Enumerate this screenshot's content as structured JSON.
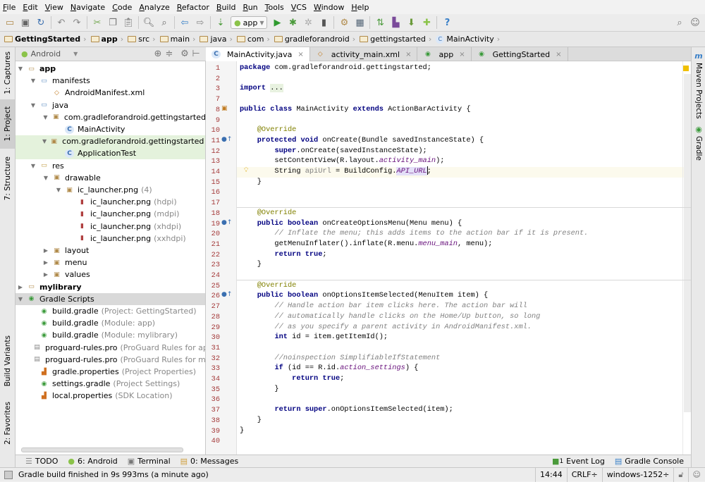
{
  "menu": [
    "File",
    "Edit",
    "View",
    "Navigate",
    "Code",
    "Analyze",
    "Refactor",
    "Build",
    "Run",
    "Tools",
    "VCS",
    "Window",
    "Help"
  ],
  "toolbar": {
    "run_config": "app"
  },
  "breadcrumb": [
    "GettingStarted",
    "app",
    "src",
    "main",
    "java",
    "com",
    "gradleforandroid",
    "gettingstarted",
    "MainActivity"
  ],
  "left_stripe": [
    "1: Captures",
    "1: Project",
    "7: Structure",
    "Build Variants",
    "2: Favorites"
  ],
  "right_stripe": [
    "Maven Projects",
    "Gradle"
  ],
  "project_panel": {
    "view": "Android"
  },
  "tree": [
    {
      "depth": 0,
      "tri": "open",
      "icon": "module",
      "label": "app",
      "bold": true
    },
    {
      "depth": 1,
      "tri": "open",
      "icon": "folder",
      "label": "manifests"
    },
    {
      "depth": 2,
      "icon": "xml",
      "label": "AndroidManifest.xml"
    },
    {
      "depth": 1,
      "tri": "open",
      "icon": "folder",
      "label": "java"
    },
    {
      "depth": 2,
      "tri": "open",
      "icon": "package",
      "label": "com.gradleforandroid.gettingstarted"
    },
    {
      "depth": 3,
      "icon": "class",
      "label": "MainActivity"
    },
    {
      "depth": 2,
      "tri": "open",
      "icon": "package",
      "label": "com.gradleforandroid.gettingstarted",
      "muted": "(androidTest)",
      "state": "sel"
    },
    {
      "depth": 3,
      "icon": "testclass",
      "label": "ApplicationTest",
      "state": "sel"
    },
    {
      "depth": 1,
      "tri": "open",
      "icon": "resfolder",
      "label": "res"
    },
    {
      "depth": 2,
      "tri": "open",
      "icon": "package",
      "label": "drawable"
    },
    {
      "depth": 3,
      "tri": "open",
      "icon": "package",
      "label": "ic_launcher.png",
      "muted": "(4)"
    },
    {
      "depth": 4,
      "icon": "image",
      "label": "ic_launcher.png",
      "muted": "(hdpi)"
    },
    {
      "depth": 4,
      "icon": "image",
      "label": "ic_launcher.png",
      "muted": "(mdpi)"
    },
    {
      "depth": 4,
      "icon": "image",
      "label": "ic_launcher.png",
      "muted": "(xhdpi)"
    },
    {
      "depth": 4,
      "icon": "image",
      "label": "ic_launcher.png",
      "muted": "(xxhdpi)"
    },
    {
      "depth": 2,
      "tri": "closed",
      "icon": "package",
      "label": "layout"
    },
    {
      "depth": 2,
      "tri": "closed",
      "icon": "package",
      "label": "menu"
    },
    {
      "depth": 2,
      "tri": "closed",
      "icon": "package",
      "label": "values"
    },
    {
      "depth": 0,
      "tri": "closed",
      "icon": "module",
      "label": "mylibrary",
      "bold": true
    },
    {
      "depth": 0,
      "tri": "open",
      "icon": "gradle",
      "label": "Gradle Scripts",
      "state": "hl"
    },
    {
      "depth": 1,
      "icon": "gradle",
      "label": "build.gradle",
      "muted": "(Project: GettingStarted)"
    },
    {
      "depth": 1,
      "icon": "gradle",
      "label": "build.gradle",
      "muted": "(Module: app)"
    },
    {
      "depth": 1,
      "icon": "gradle",
      "label": "build.gradle",
      "muted": "(Module: mylibrary)"
    },
    {
      "depth": 1,
      "icon": "text",
      "label": "proguard-rules.pro",
      "muted": "(ProGuard Rules for app)"
    },
    {
      "depth": 1,
      "icon": "text",
      "label": "proguard-rules.pro",
      "muted": "(ProGuard Rules for mylibrary)"
    },
    {
      "depth": 1,
      "icon": "props",
      "label": "gradle.properties",
      "muted": "(Project Properties)"
    },
    {
      "depth": 1,
      "icon": "gradle",
      "label": "settings.gradle",
      "muted": "(Project Settings)"
    },
    {
      "depth": 1,
      "icon": "props",
      "label": "local.properties",
      "muted": "(SDK Location)"
    }
  ],
  "editor_tabs": [
    {
      "label": "MainActivity.java",
      "icon": "class",
      "active": true
    },
    {
      "label": "activity_main.xml",
      "icon": "xml"
    },
    {
      "label": "app",
      "icon": "gradle"
    },
    {
      "label": "GettingStarted",
      "icon": "gradle"
    }
  ],
  "code": [
    {
      "n": "1",
      "s": [
        [
          "k",
          "package"
        ],
        [
          "p",
          " com.gradleforandroid.gettingstarted;"
        ]
      ]
    },
    {
      "n": "2",
      "s": []
    },
    {
      "n": "3",
      "s": [
        [
          "k",
          "import"
        ],
        [
          "p",
          " "
        ],
        [
          "fb",
          "..."
        ]
      ]
    },
    {
      "n": "7",
      "s": []
    },
    {
      "n": "8",
      "s": [
        [
          "k",
          "public class"
        ],
        [
          "p",
          " MainActivity "
        ],
        [
          "k",
          "extends"
        ],
        [
          "p",
          " ActionBarActivity {"
        ]
      ],
      "mark": "activity"
    },
    {
      "n": "9",
      "s": []
    },
    {
      "n": "10",
      "s": [
        [
          "p",
          "    "
        ],
        [
          "a",
          "@Override"
        ]
      ]
    },
    {
      "n": "11",
      "s": [
        [
          "p",
          "    "
        ],
        [
          "k",
          "protected void"
        ],
        [
          "p",
          " onCreate(Bundle savedInstanceState) {"
        ]
      ],
      "mark": "override"
    },
    {
      "n": "12",
      "s": [
        [
          "p",
          "        "
        ],
        [
          "k",
          "super"
        ],
        [
          "p",
          ".onCreate(savedInstanceState);"
        ]
      ]
    },
    {
      "n": "13",
      "s": [
        [
          "p",
          "        setContentView(R.layout."
        ],
        [
          "f",
          "activity_main"
        ],
        [
          "p",
          ");"
        ]
      ]
    },
    {
      "n": "14",
      "s": [
        [
          "p",
          "        String "
        ],
        [
          "g",
          "apiUrl"
        ],
        [
          "p",
          " = BuildConfig."
        ],
        [
          "fh",
          "API_URL"
        ],
        [
          "p",
          ";"
        ]
      ],
      "current": true,
      "mark": "bulb"
    },
    {
      "n": "15",
      "s": [
        [
          "p",
          "    }"
        ]
      ]
    },
    {
      "n": "16",
      "s": []
    },
    {
      "n": "17",
      "s": [],
      "sep": true
    },
    {
      "n": "18",
      "s": [
        [
          "p",
          "    "
        ],
        [
          "a",
          "@Override"
        ]
      ]
    },
    {
      "n": "19",
      "s": [
        [
          "p",
          "    "
        ],
        [
          "k",
          "public boolean"
        ],
        [
          "p",
          " onCreateOptionsMenu(Menu menu) {"
        ]
      ],
      "mark": "override"
    },
    {
      "n": "20",
      "s": [
        [
          "p",
          "        "
        ],
        [
          "c",
          "// Inflate the menu; this adds items to the action bar if it is present."
        ]
      ]
    },
    {
      "n": "21",
      "s": [
        [
          "p",
          "        getMenuInflater().inflate(R.menu."
        ],
        [
          "f",
          "menu_main"
        ],
        [
          "p",
          ", menu);"
        ]
      ]
    },
    {
      "n": "22",
      "s": [
        [
          "p",
          "        "
        ],
        [
          "k",
          "return true"
        ],
        [
          "p",
          ";"
        ]
      ]
    },
    {
      "n": "23",
      "s": [
        [
          "p",
          "    }"
        ]
      ]
    },
    {
      "n": "24",
      "s": [],
      "sep": true
    },
    {
      "n": "25",
      "s": [
        [
          "p",
          "    "
        ],
        [
          "a",
          "@Override"
        ]
      ]
    },
    {
      "n": "26",
      "s": [
        [
          "p",
          "    "
        ],
        [
          "k",
          "public boolean"
        ],
        [
          "p",
          " onOptionsItemSelected(MenuItem item) {"
        ]
      ],
      "mark": "override"
    },
    {
      "n": "27",
      "s": [
        [
          "p",
          "        "
        ],
        [
          "c",
          "// Handle action bar item clicks here. The action bar will"
        ]
      ]
    },
    {
      "n": "28",
      "s": [
        [
          "p",
          "        "
        ],
        [
          "c",
          "// automatically handle clicks on the Home/Up button, so long"
        ]
      ]
    },
    {
      "n": "29",
      "s": [
        [
          "p",
          "        "
        ],
        [
          "c",
          "// as you specify a parent activity in AndroidManifest.xml."
        ]
      ]
    },
    {
      "n": "30",
      "s": [
        [
          "p",
          "        "
        ],
        [
          "k",
          "int"
        ],
        [
          "p",
          " id = item.getItemId();"
        ]
      ]
    },
    {
      "n": "31",
      "s": []
    },
    {
      "n": "32",
      "s": [
        [
          "p",
          "        "
        ],
        [
          "c",
          "//noinspection SimplifiableIfStatement"
        ]
      ]
    },
    {
      "n": "33",
      "s": [
        [
          "p",
          "        "
        ],
        [
          "k",
          "if"
        ],
        [
          "p",
          " (id == R.id."
        ],
        [
          "f",
          "action_settings"
        ],
        [
          "p",
          ") {"
        ]
      ]
    },
    {
      "n": "34",
      "s": [
        [
          "p",
          "            "
        ],
        [
          "k",
          "return true"
        ],
        [
          "p",
          ";"
        ]
      ]
    },
    {
      "n": "35",
      "s": [
        [
          "p",
          "        }"
        ]
      ]
    },
    {
      "n": "36",
      "s": []
    },
    {
      "n": "37",
      "s": [
        [
          "p",
          "        "
        ],
        [
          "k",
          "return super"
        ],
        [
          "p",
          ".onOptionsItemSelected(item);"
        ]
      ]
    },
    {
      "n": "38",
      "s": [
        [
          "p",
          "    }"
        ]
      ]
    },
    {
      "n": "39",
      "s": [
        [
          "p",
          "}"
        ]
      ]
    },
    {
      "n": "40",
      "s": []
    }
  ],
  "bottom_tabs": {
    "left": [
      "TODO",
      "6: Android",
      "Terminal",
      "0: Messages"
    ],
    "right": [
      "Event Log",
      "Gradle Console"
    ],
    "event_count": "1"
  },
  "status": {
    "message": "Gradle build finished in 9s 993ms (a minute ago)",
    "position": "14:44",
    "line_sep": "CRLF÷",
    "encoding": "windows-1252÷"
  },
  "colors": {
    "keyword": "#000080",
    "annotation": "#808000",
    "comment": "#808080",
    "field": "#660e7a",
    "selection": "#e4f2dc"
  }
}
